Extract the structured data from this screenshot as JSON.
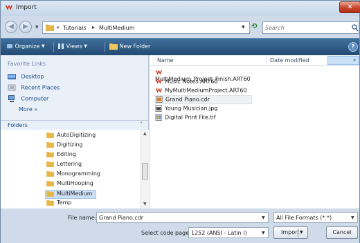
{
  "window": {
    "title": "Import",
    "close_label": "×"
  },
  "address": {
    "root_glyph": "«",
    "crumbs": [
      "Tutorials",
      "MultiMedium"
    ],
    "separator": "▸"
  },
  "search": {
    "placeholder": "Search"
  },
  "toolbar": {
    "organize": "Organize",
    "views": "Views",
    "new_folder": "New Folder",
    "help": "?"
  },
  "favorites": {
    "title": "Favorite Links",
    "items": [
      "Desktop",
      "Recent Places",
      "Computer"
    ],
    "more": "More »"
  },
  "folders": {
    "title": "Folders",
    "items": [
      "AutoDigitizing",
      "Digitizing",
      "Editing",
      "Lettering",
      "Monogramming",
      "MultiHooping",
      "MultiMedium",
      "Temp"
    ],
    "selected": "MultiMedium"
  },
  "filelist": {
    "columns": [
      "Name",
      "Date modified"
    ],
    "files": [
      {
        "name": "MultiMedium_Project_Finish.ART60",
        "icon": "art-file-icon"
      },
      {
        "name": "Music Notes.ART60",
        "icon": "art-file-icon"
      },
      {
        "name": "MyMultiMediumProject.ART60",
        "icon": "art-file-icon"
      },
      {
        "name": "Grand Piano.cdr",
        "icon": "cdr-file-icon"
      },
      {
        "name": "Young Musician.jpg",
        "icon": "jpg-file-icon"
      },
      {
        "name": "Digital Print File.tif",
        "icon": "tif-file-icon"
      }
    ],
    "selected": "Grand Piano.cdr"
  },
  "bottom": {
    "filename_label": "File name:",
    "filename_value": "Grand Piano.cdr",
    "filetype_value": "All File Formats (*.*)",
    "codepage_label": "Select code page",
    "codepage_value": "1252  (ANSI - Latin I)",
    "import_label": "Import",
    "cancel_label": "Cancel"
  },
  "colors": {
    "accent": "#234b74",
    "selection": "#cde0f6",
    "close": "#c7442c"
  }
}
